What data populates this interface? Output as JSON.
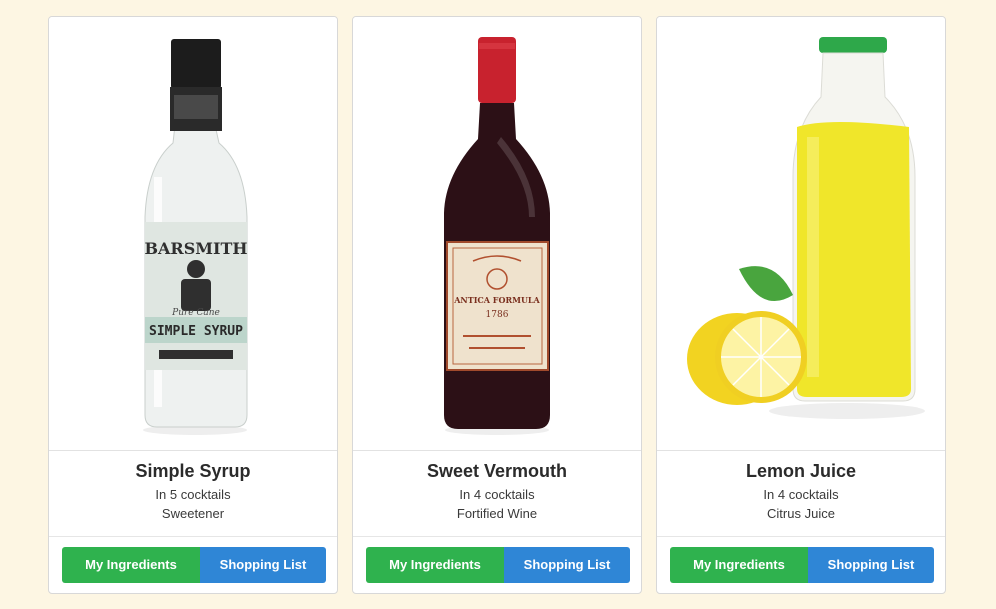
{
  "cards": [
    {
      "name": "Simple Syrup",
      "count": "In 5 cocktails",
      "category": "Sweetener",
      "label_brand": "BARSMITH",
      "label_product": "SIMPLE SYRUP",
      "label_sub": "Pure Cane",
      "primary_button": "My Ingredients",
      "secondary_button": "Shopping List"
    },
    {
      "name": "Sweet Vermouth",
      "count": "In 4 cocktails",
      "category": "Fortified Wine",
      "label_brand": "ANTICA FORMULA",
      "label_year": "1786",
      "primary_button": "My Ingredients",
      "secondary_button": "Shopping List"
    },
    {
      "name": "Lemon Juice",
      "count": "In 4 cocktails",
      "category": "Citrus Juice",
      "primary_button": "My Ingredients",
      "secondary_button": "Shopping List"
    }
  ],
  "colors": {
    "background": "#fdf6e3",
    "primary_button": "#2fb24e",
    "secondary_button": "#2f86d6"
  }
}
